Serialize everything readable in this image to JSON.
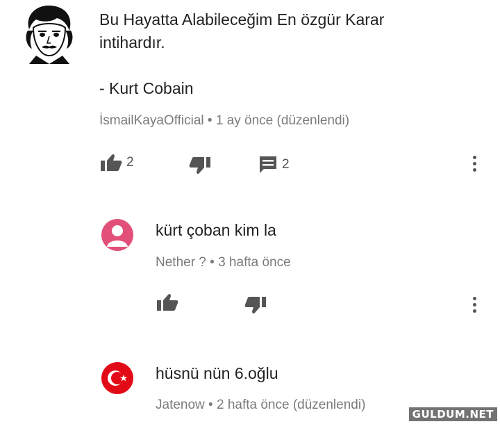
{
  "comments": [
    {
      "avatar_icon": "poe-portrait-avatar",
      "text_line1": "Bu Hayatta Alabileceğim En özgür Karar",
      "text_line2": "intihardır.",
      "quote": "- Kurt Cobain",
      "meta": "İsmailKayaOfficial • 1 ay önce (düzenlendi)",
      "likes": "2",
      "replies": "2"
    },
    {
      "avatar_icon": "default-user-avatar",
      "avatar_color": "#e2507a",
      "text": "kürt çoban kim la",
      "meta": "Nether ? • 3 hafta önce"
    },
    {
      "avatar_icon": "turkish-flag-avatar",
      "avatar_color": "#e30a17",
      "text": "hüsnü nün 6.oğlu",
      "meta": "Jatenow • 2 hafta önce (düzenlendi)"
    }
  ],
  "watermark": "GULDUM.NET"
}
